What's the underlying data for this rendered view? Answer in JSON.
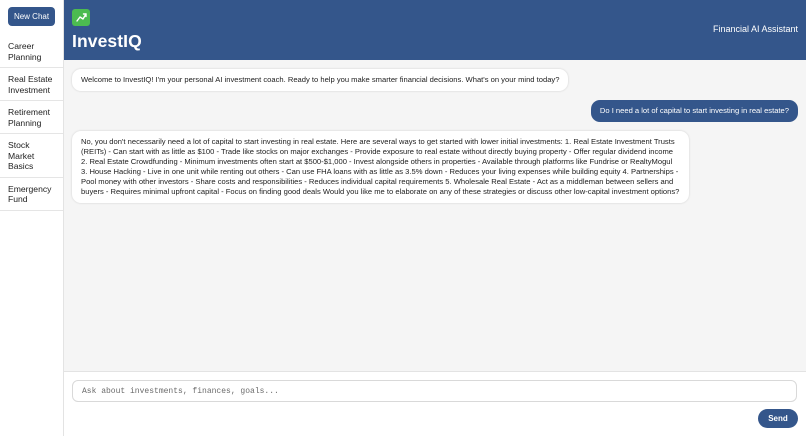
{
  "app": {
    "name": "InvestIQ",
    "subtitle": "Financial AI Assistant",
    "logo_icon": "chart-growth-icon",
    "accent_color": "#34568b",
    "logo_color": "#4cbb50"
  },
  "sidebar": {
    "new_chat_label": "New Chat",
    "items": [
      {
        "label": "Career Planning"
      },
      {
        "label": "Real Estate Investment"
      },
      {
        "label": "Retirement Planning"
      },
      {
        "label": "Stock Market Basics"
      },
      {
        "label": "Emergency Fund"
      }
    ]
  },
  "messages": [
    {
      "role": "assistant",
      "text": "Welcome to InvestIQ! I'm your personal AI investment coach. Ready to help you make smarter financial decisions. What's on your mind today?"
    },
    {
      "role": "user",
      "text": "Do I need a lot of capital to start investing in real estate?"
    },
    {
      "role": "assistant",
      "text": "No, you don't necessarily need a lot of capital to start investing in real estate. Here are several ways to get started with lower initial investments: 1. Real Estate Investment Trusts (REITs) - Can start with as little as $100 - Trade like stocks on major exchanges - Provide exposure to real estate without directly buying property - Offer regular dividend income 2. Real Estate Crowdfunding - Minimum investments often start at $500-$1,000 - Invest alongside others in properties - Available through platforms like Fundrise or RealtyMogul 3. House Hacking - Live in one unit while renting out others - Can use FHA loans with as little as 3.5% down - Reduces your living expenses while building equity 4. Partnerships - Pool money with other investors - Share costs and responsibilities - Reduces individual capital requirements 5. Wholesale Real Estate - Act as a middleman between sellers and buyers - Requires minimal upfront capital - Focus on finding good deals Would you like me to elaborate on any of these strategies or discuss other low-capital investment options?"
    }
  ],
  "composer": {
    "placeholder": "Ask about investments, finances, goals...",
    "value": "",
    "send_label": "Send"
  }
}
